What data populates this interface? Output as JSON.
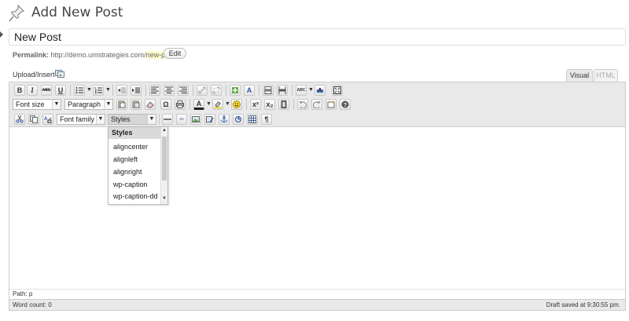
{
  "header": {
    "title": "Add New Post"
  },
  "post": {
    "title_value": "New Post",
    "permalink_label": "Permalink:",
    "permalink_base": "http://demo.umstrategies.com/",
    "permalink_slug": "new-post",
    "permalink_trailing": "/",
    "edit_label": "Edit"
  },
  "media": {
    "upload_label": "Upload/Insert"
  },
  "tabs": {
    "visual": "Visual",
    "html": "HTML"
  },
  "toolbar": {
    "bold": "B",
    "italic": "I",
    "strike": "ABC",
    "underline": "U",
    "font_size": "Font size",
    "format": "Paragraph",
    "font_family": "Font family",
    "styles": "Styles",
    "superscript": "x²",
    "subscript": "x₂",
    "omega": "Ω",
    "text_color": "A",
    "pilcrow": "¶"
  },
  "styles_menu": {
    "header": "Styles",
    "items": [
      "aligncenter",
      "alignleft",
      "alignright",
      "wp-caption",
      "wp-caption-dd"
    ]
  },
  "status": {
    "path": "Path: p",
    "word_count": "Word count: 0",
    "draft_saved": "Draft saved at 9:30:55 pm."
  }
}
